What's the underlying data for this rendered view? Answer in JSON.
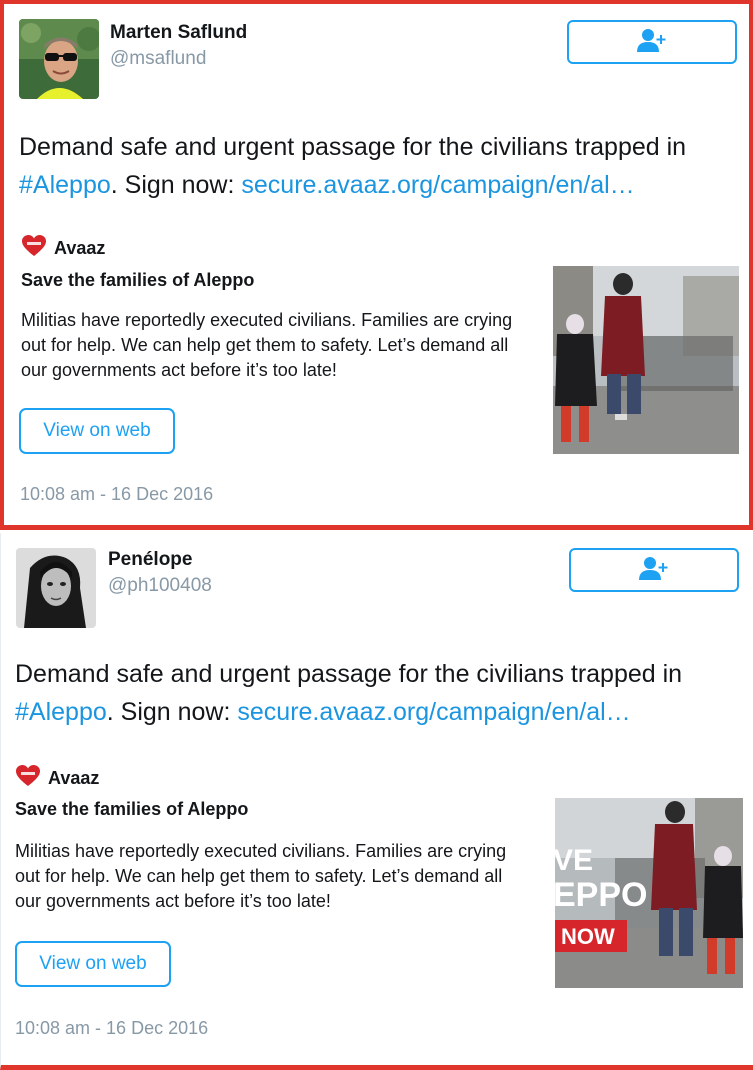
{
  "tweets": [
    {
      "author_name": "Marten Saflund",
      "author_handle": "@msaflund",
      "text_main": "Demand safe and urgent passage for the civilians trapped in ",
      "hashtag": "#Aleppo",
      "text_mid": ". Sign now: ",
      "link": "secure.avaaz.org/campaign/en/al…",
      "card": {
        "source": "Avaaz",
        "title": "Save the families of Aleppo",
        "description": "Militias have reportedly executed civilians. Families are crying out for help. We can help get them to safety. Let’s demand all our governments act before it’s too late!",
        "button_label": "View on web"
      },
      "timestamp": "10:08 am - 16 Dec 2016"
    },
    {
      "author_name": "Penélope",
      "author_handle": "@ph100408",
      "text_main": "Demand safe and urgent passage for the civilians trapped in ",
      "hashtag": "#Aleppo",
      "text_mid": ". Sign now: ",
      "link": "secure.avaaz.org/campaign/en/al…",
      "card": {
        "source": "Avaaz",
        "title": "Save the families of Aleppo",
        "description": "Militias have reportedly executed civilians. Families are crying out for help. We can help get them to safety. Let’s demand all our governments act before it’s too late!",
        "button_label": "View on web",
        "image_overlay": [
          "VE",
          "EPPO",
          "NOW"
        ]
      },
      "timestamp": "10:08 am - 16 Dec 2016"
    }
  ],
  "icons": {
    "follow": "add-user-icon",
    "source_logo": "avaaz-heart-icon"
  },
  "colors": {
    "accent": "#1da1f2",
    "link": "#1b95e0",
    "highlight_border": "#e0352b",
    "muted": "#8899a6"
  }
}
